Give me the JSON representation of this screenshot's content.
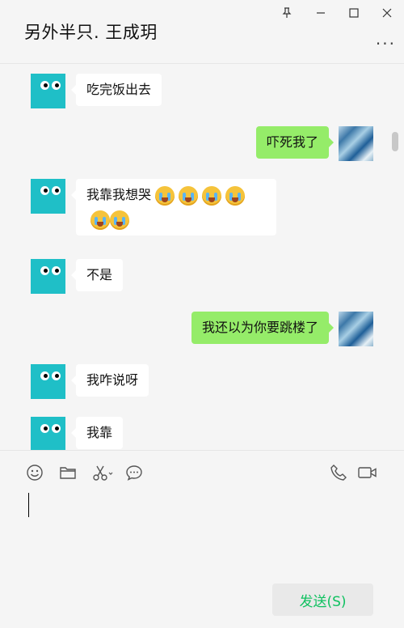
{
  "window": {
    "title": "另外半只. 王成玥",
    "more_label": "..."
  },
  "messages": [
    {
      "side": "in",
      "text": "吃完饭出去"
    },
    {
      "side": "out",
      "text": "吓死我了"
    },
    {
      "side": "in",
      "text": "我靠我想哭",
      "emoji": "loudly-crying-face",
      "emoji_count": 6
    },
    {
      "side": "in",
      "text": "不是"
    },
    {
      "side": "out",
      "text": "我还以为你要跳楼了"
    },
    {
      "side": "in",
      "text": "我咋说呀"
    },
    {
      "side": "in",
      "text": "我靠"
    }
  ],
  "toolbar": {
    "icons": [
      "emoji-icon",
      "folder-icon",
      "scissors-icon",
      "chat-bubble-icon",
      "phone-icon",
      "video-call-icon"
    ]
  },
  "input": {
    "send_label": "发送(S)"
  },
  "colors": {
    "outgoing_bubble": "#95ec69",
    "incoming_bubble": "#ffffff",
    "send_text": "#0fc160",
    "avatar_teal": "#1fbfc7"
  }
}
